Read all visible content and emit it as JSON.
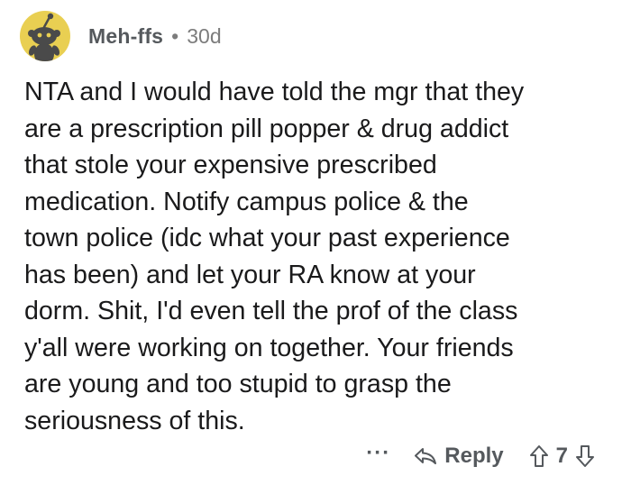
{
  "comment": {
    "username": "Meh-ffs",
    "separator": "•",
    "age": "30d",
    "body": "NTA and I would have told the mgr that they\nare a prescription pill popper & drug addict\nthat stole your expensive prescribed\nmedication. Notify campus police & the\ntown police (idc what your past experience\nhas been) and let your RA know at your\ndorm. Shit, I'd even tell the prof of the class\ny'all were working on together. Your friends\nare young and too stupid to grasp the\nseriousness of this.",
    "actions": {
      "more_label": "···",
      "reply_label": "Reply",
      "score": "7"
    }
  },
  "colors": {
    "avatar_bg": "#e9cf52",
    "avatar_figure": "#4a4a4a",
    "meta_text": "#55595d",
    "body_text": "#1a1a1b"
  },
  "icons": {
    "avatar": "snoo-avatar-icon",
    "reply": "reply-arrow-icon",
    "upvote": "upvote-arrow-icon",
    "downvote": "downvote-arrow-icon"
  }
}
